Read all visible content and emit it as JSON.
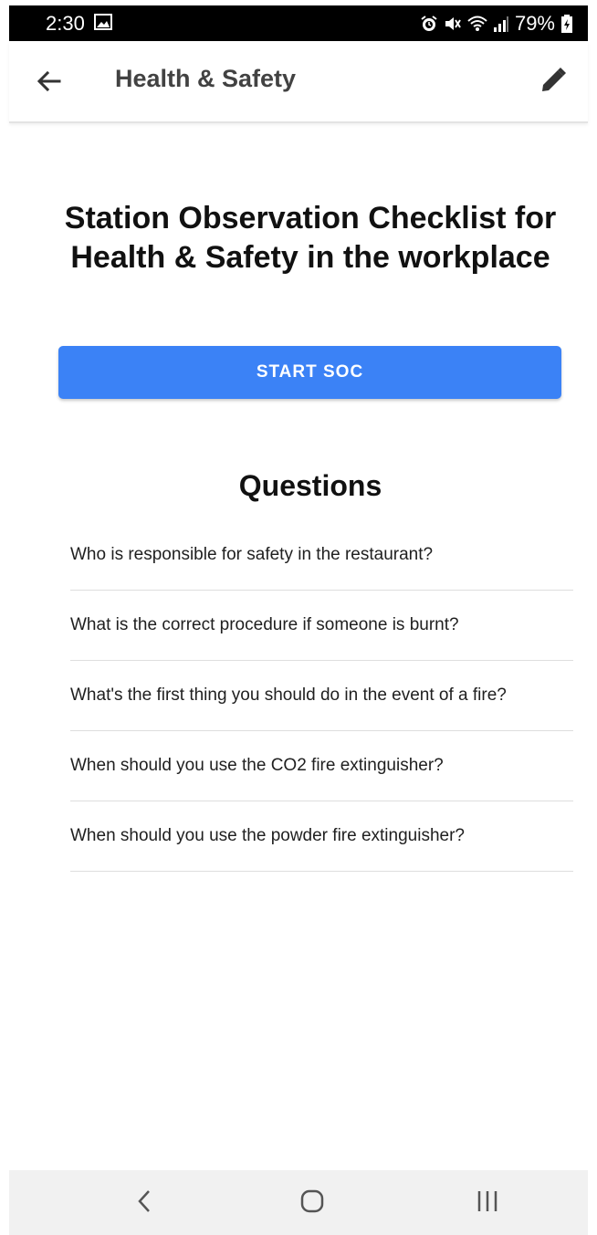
{
  "status_bar": {
    "time": "2:30",
    "battery": "79%",
    "icons": [
      "image-icon",
      "alarm-icon",
      "mute-icon",
      "wifi-icon",
      "signal-icon",
      "battery-icon"
    ]
  },
  "app_bar": {
    "title": "Health & Safety",
    "back_icon": "arrow-left-icon",
    "edit_icon": "pencil-icon"
  },
  "main": {
    "heading": "Station Observation Checklist for Health & Safety in the workplace",
    "start_button": "START SOC",
    "questions_title": "Questions",
    "questions": [
      "Who is responsible for safety in the restaurant?",
      "What is the correct procedure if someone is burnt?",
      "What's the first thing you should do in the event of a fire?",
      "When should you use the CO2 fire extinguisher?",
      "When should you use the powder fire extinguisher?"
    ]
  },
  "nav_bar": {
    "buttons": [
      "back-nav-icon",
      "home-nav-icon",
      "recents-nav-icon"
    ]
  },
  "colors": {
    "primary": "#3b82f6",
    "status_bar": "#000000",
    "nav_bar": "#f1f1f1",
    "divider": "#dedede"
  }
}
